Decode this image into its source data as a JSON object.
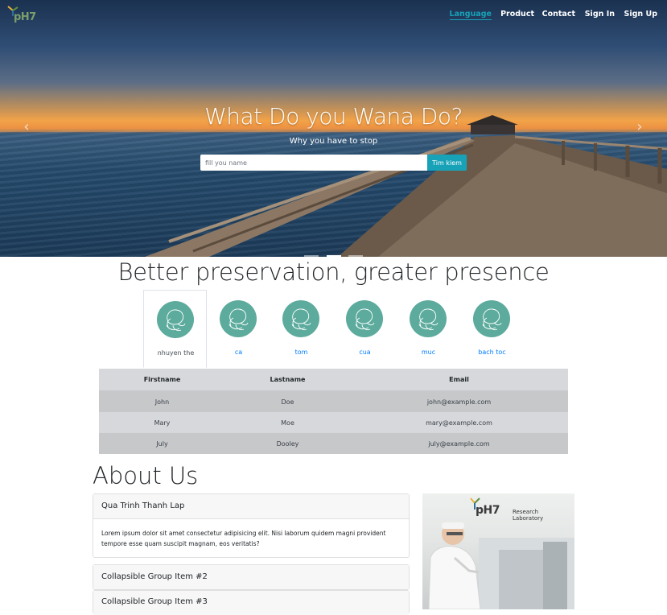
{
  "brand": {
    "logo_text": "pH7",
    "accent": "#17a2b8"
  },
  "nav": {
    "items": [
      {
        "label": "Language",
        "active": true
      },
      {
        "label": "Product"
      },
      {
        "label": "Contact"
      },
      {
        "label": "Sign In"
      },
      {
        "label": "Sign Up"
      }
    ]
  },
  "hero": {
    "title": "What Do you Wana Do?",
    "subtitle": "Why you have to stop",
    "search_placeholder": "fill you name",
    "search_button": "Tim kiem",
    "prev_icon": "‹",
    "next_icon": "›"
  },
  "section": {
    "heading": "Better preservation, greater presence"
  },
  "tabs": [
    {
      "label": "nhuyen the",
      "active": true
    },
    {
      "label": "ca"
    },
    {
      "label": "tom"
    },
    {
      "label": "cua"
    },
    {
      "label": "muc"
    },
    {
      "label": "bach toc"
    }
  ],
  "table": {
    "headers": [
      "Firstname",
      "Lastname",
      "Email"
    ],
    "rows": [
      [
        "John",
        "Doe",
        "john@example.com"
      ],
      [
        "Mary",
        "Moe",
        "mary@example.com"
      ],
      [
        "July",
        "Dooley",
        "july@example.com"
      ]
    ]
  },
  "about": {
    "title": "About Us",
    "cards": [
      {
        "header": "Qua Trinh Thanh Lap",
        "body": "Lorem ipsum dolor sit amet consectetur adipisicing elit. Nisi laborum quidem magni provident tempore esse quam suscipit magnam, eos veritatis?"
      },
      {
        "header": "Collapsible Group Item #2"
      },
      {
        "header": "Collapsible Group Item #3"
      }
    ],
    "image": {
      "brand": "pH7",
      "caption_line1": "Research",
      "caption_line2": "Laboratory"
    }
  }
}
